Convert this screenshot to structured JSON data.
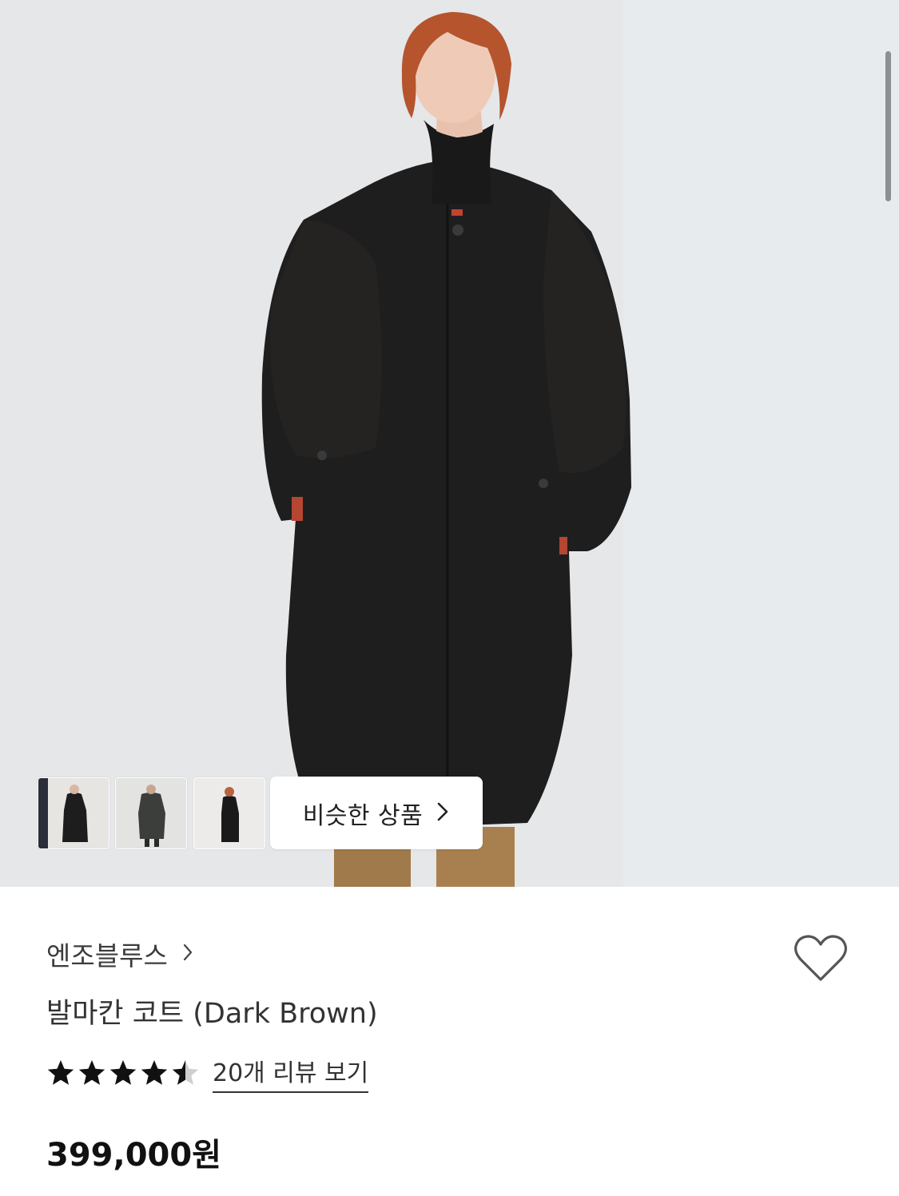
{
  "hero": {
    "image_subject": "model-in-long-dark-coat",
    "thumbnails": [
      {
        "alt": "thumbnail-1"
      },
      {
        "alt": "thumbnail-2"
      },
      {
        "alt": "thumbnail-3"
      }
    ],
    "similar_button_label": "비슷한 상품"
  },
  "product": {
    "brand": "엔조블루스",
    "title": "발마칸 코트 (Dark Brown)",
    "rating": 4.5,
    "rating_max": 5,
    "review_link": "20개 리뷰 보기",
    "price": "399,000원"
  },
  "colors": {
    "accent_text": "#1a1a1a",
    "star_fill": "#111111",
    "star_empty": "#cfcfcf",
    "background_wall": "#e6e8ea",
    "coat": "#1f1e1e"
  },
  "icons": {
    "brand_chevron": "chevron-right-icon",
    "similar_chevron": "chevron-right-icon",
    "wishlist": "heart-outline-icon",
    "rating": "star-icon"
  }
}
